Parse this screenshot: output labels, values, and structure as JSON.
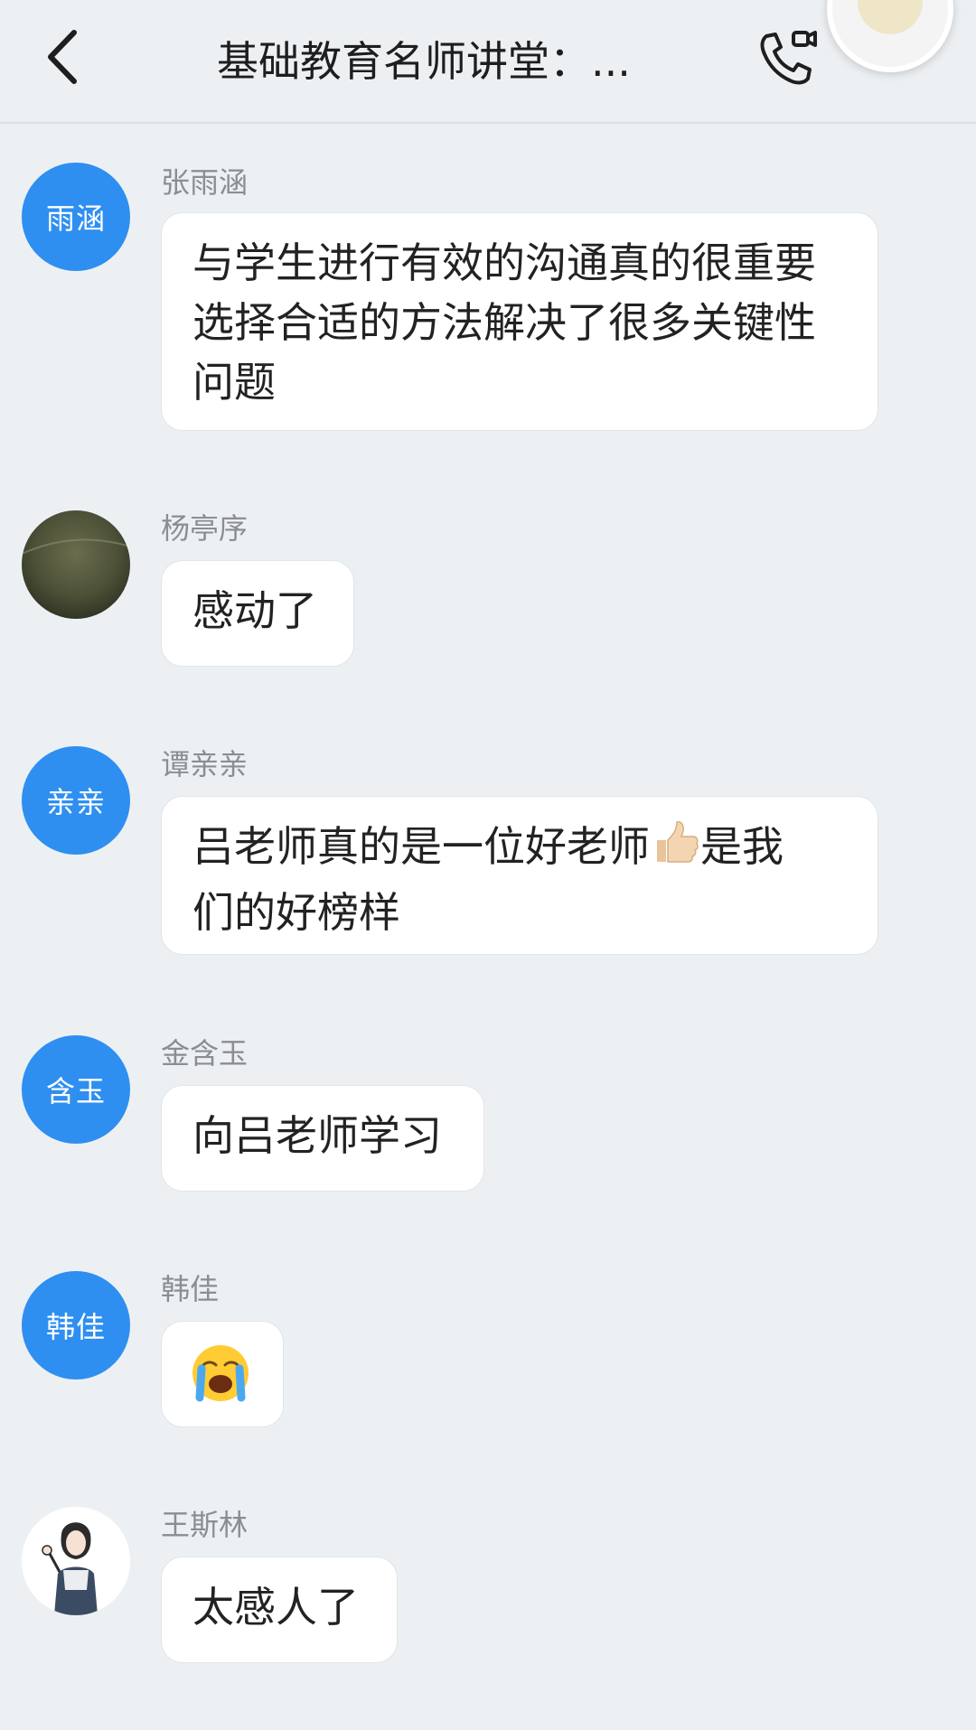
{
  "header": {
    "title": "基础教育名师讲堂：...",
    "back_icon": "chevron-left-icon",
    "call_icon": "phone-video-icon",
    "more_icon": "more-dots-icon"
  },
  "messages": [
    {
      "sender": "张雨涵",
      "avatar_text": "雨涵",
      "avatar_type": "text",
      "lines": [
        "与学生进行有效的沟通真的很重要",
        "选择合适的方法解决了很多关键性",
        "问题"
      ]
    },
    {
      "sender": "杨亭序",
      "avatar_type": "photo",
      "lines": [
        "感动了"
      ]
    },
    {
      "sender": "谭亲亲",
      "avatar_text": "亲亲",
      "avatar_type": "text",
      "lines_parts": [
        "吕老师真的是一位好老师",
        "是我",
        "们的好榜样"
      ],
      "emoji": "thumbs-up-icon"
    },
    {
      "sender": "金含玉",
      "avatar_text": "含玉",
      "avatar_type": "text",
      "lines": [
        "向吕老师学习"
      ]
    },
    {
      "sender": "韩佳",
      "avatar_text": "韩佳",
      "avatar_type": "text",
      "emoji": "loudly-crying-face-icon"
    },
    {
      "sender": "王斯林",
      "avatar_type": "illustration",
      "lines": [
        "太感人了"
      ]
    }
  ],
  "colors": {
    "background": "#edf0f3",
    "avatar_blue": "#2e8ff1",
    "bubble": "#ffffff",
    "sender_gray": "#8a8d93"
  }
}
